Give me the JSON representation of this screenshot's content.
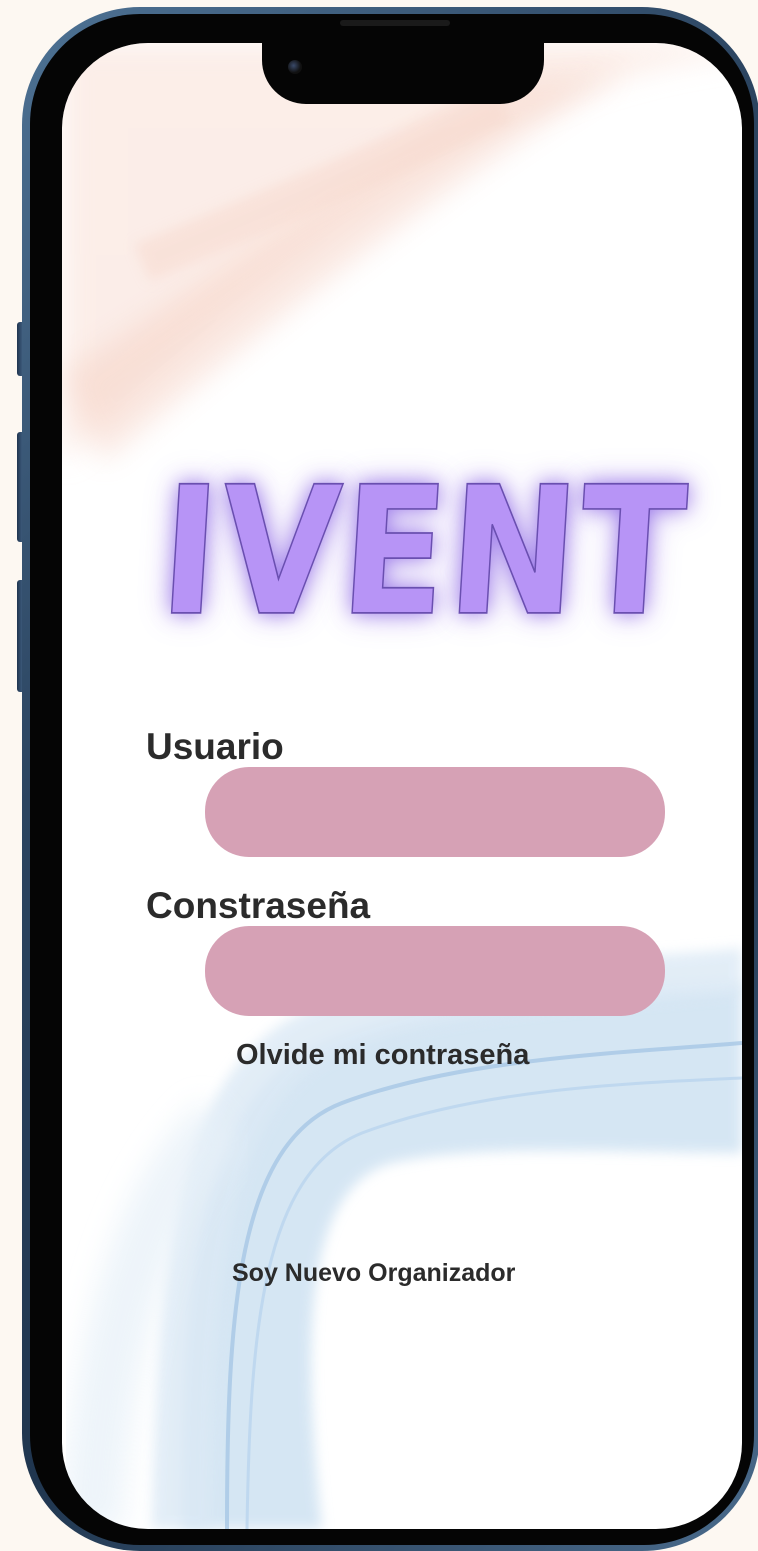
{
  "app": {
    "logo_text": "IVENT",
    "brand_color": "#b794f6",
    "input_color": "#d6a1b5"
  },
  "login": {
    "username_label": "Usuario",
    "username_value": "",
    "password_label": "Constraseña",
    "password_value": "",
    "forgot_password_link": "Olvide mi contraseña",
    "new_organizer_link": "Soy Nuevo Organizador"
  }
}
